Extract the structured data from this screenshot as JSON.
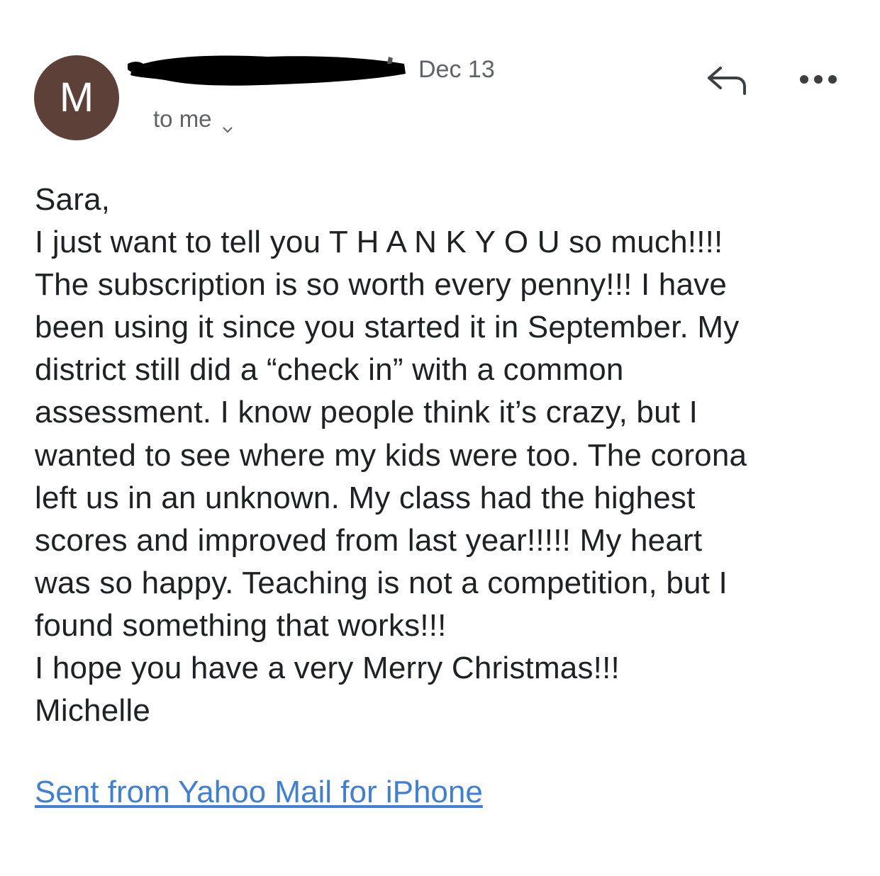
{
  "message": {
    "avatar_letter": "M",
    "avatar_color": "#5d4037",
    "date": "Dec 13",
    "recipient_label": "to me",
    "body_lines": [
      "Sara,",
      "I just want to tell you T H A N K Y O U so much!!!!",
      "The subscription is so worth every penny!!! I have",
      "been using it since you started it in September. My",
      "district still did a “check in” with a common",
      "assessment. I know people think it’s crazy, but I",
      "wanted to see where my kids were too. The corona",
      "left us in an unknown. My class had the highest",
      "scores and improved from last year!!!!! My heart",
      "was so happy. Teaching is not a competition, but I",
      "found something that works!!!",
      "I hope you have a very Merry Christmas!!!",
      "Michelle"
    ],
    "signature_link": "Sent from Yahoo Mail for iPhone",
    "link_color": "#3f7fd6"
  },
  "icons": {
    "reply": "reply-icon",
    "more": "more-horizontal-icon",
    "chevron": "chevron-down-icon"
  }
}
